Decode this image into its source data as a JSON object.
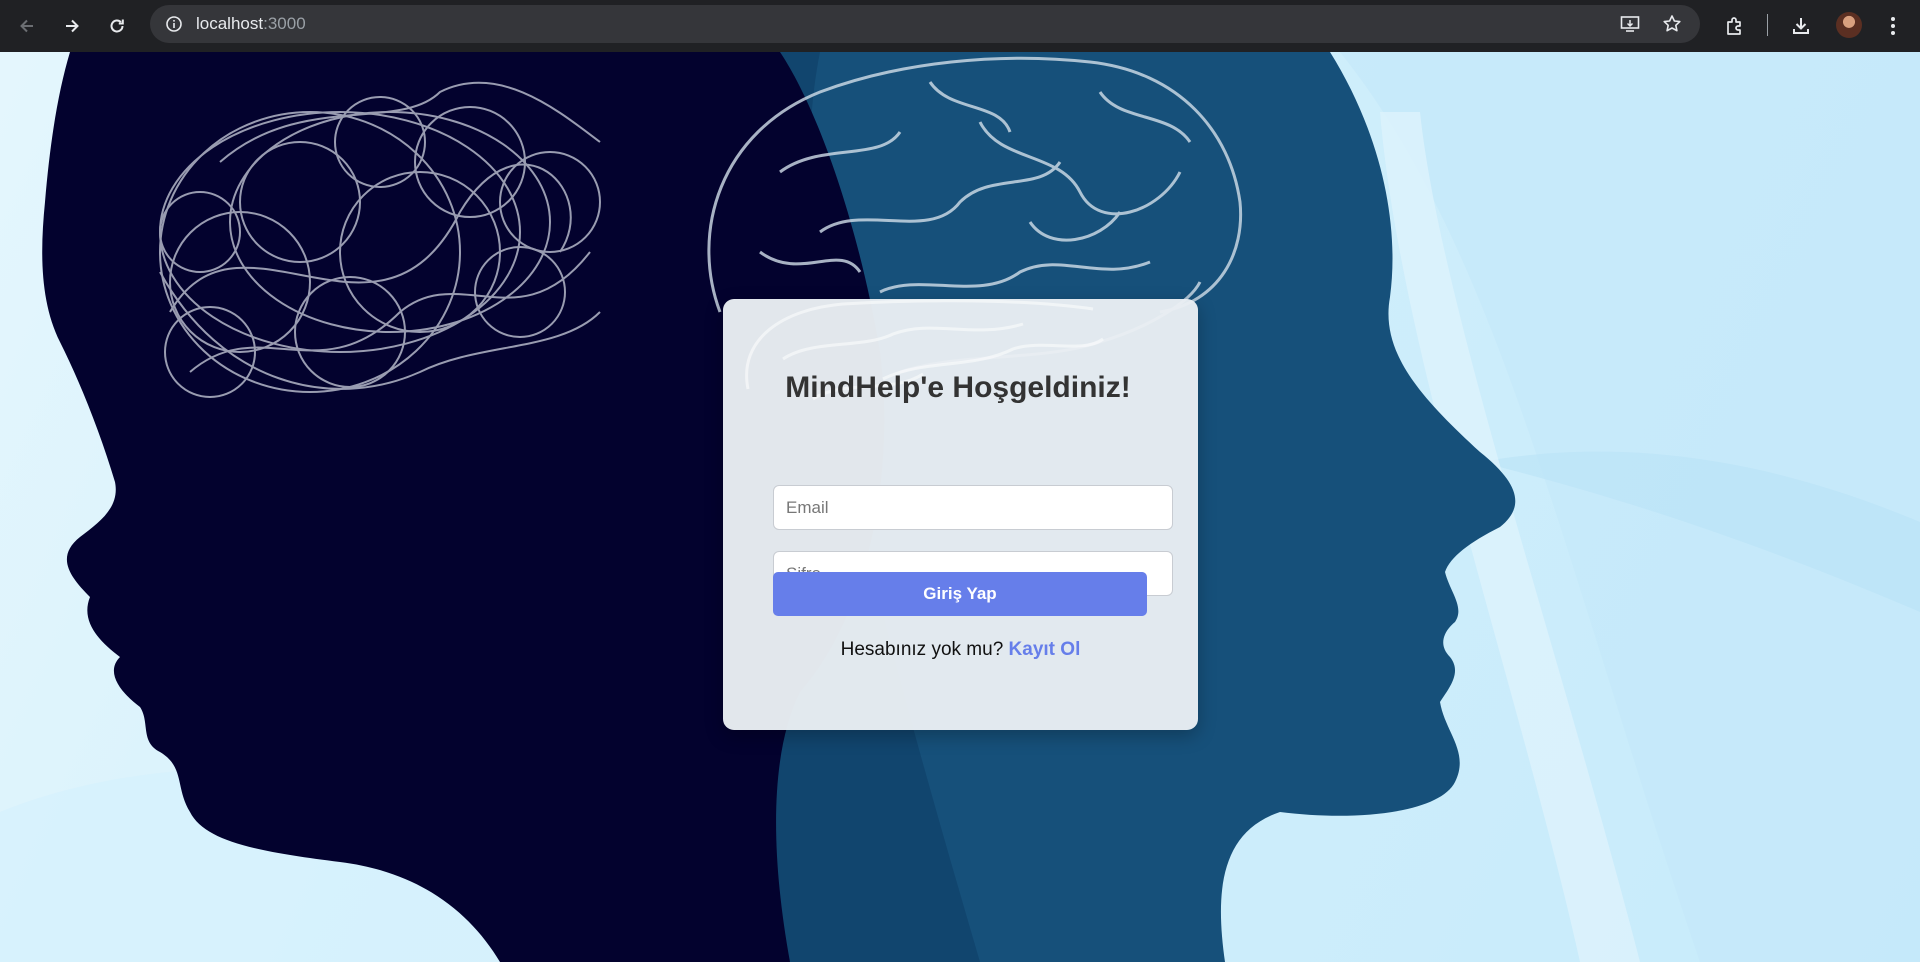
{
  "browser": {
    "url_host": "localhost",
    "url_port": ":3000"
  },
  "login": {
    "title": "MindHelp'e Hoşgeldiniz!",
    "email_placeholder": "Email",
    "password_placeholder": "Şifre",
    "submit_label": "Giriş Yap",
    "register_prompt": "Hesabınız yok mu?",
    "register_link": "Kayıt Ol"
  },
  "colors": {
    "accent": "#667eea",
    "chrome_bg": "#202124",
    "dark_head": "#03022e",
    "blue_head": "#16507a"
  }
}
